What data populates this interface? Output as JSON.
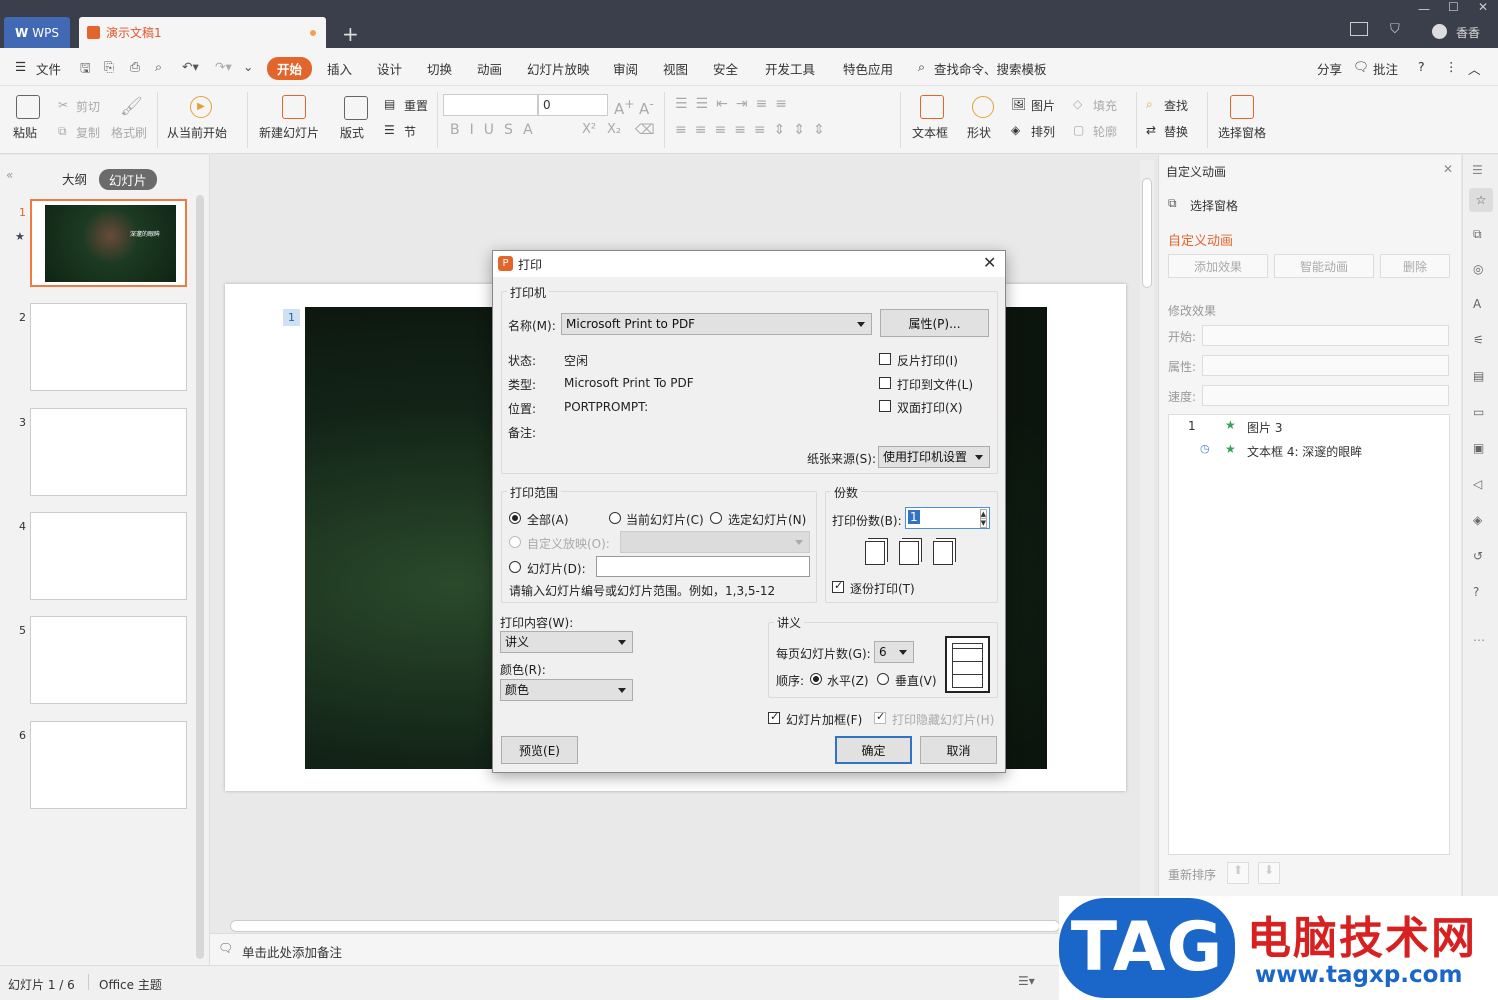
{
  "titlebar": {
    "wps_tab": "WPS",
    "doc_tab": "演示文稿1",
    "user": "香香"
  },
  "menu": {
    "file": "文件",
    "items": [
      "开始",
      "插入",
      "设计",
      "切换",
      "动画",
      "幻灯片放映",
      "审阅",
      "视图",
      "安全",
      "开发工具",
      "特色应用"
    ],
    "search": "查找命令、搜索模板",
    "share": "分享",
    "comment": "批注"
  },
  "toolbar": {
    "paste": "粘贴",
    "cut": "剪切",
    "copy": "复制",
    "format_painter": "格式刷",
    "from_current": "从当前开始",
    "new_slide": "新建幻灯片",
    "layout": "版式",
    "reset": "重置",
    "section": "节",
    "font_size": "0",
    "textbox": "文本框",
    "shape": "形状",
    "picture": "图片",
    "fill": "填充",
    "arrange": "排列",
    "outline": "轮廓",
    "find": "查找",
    "replace": "替换",
    "select_pane": "选择窗格"
  },
  "leftpane": {
    "tab_outline": "大纲",
    "tab_slides": "幻灯片",
    "slides": [
      "1",
      "2",
      "3",
      "4",
      "5",
      "6"
    ],
    "slide1_caption": "深邃的眼眸"
  },
  "slide": {
    "number": "1"
  },
  "rightpane": {
    "title": "自定义动画",
    "select_pane": "选择窗格",
    "section": "自定义动画",
    "add_effect": "添加效果",
    "smart_anim": "智能动画",
    "delete": "删除",
    "modify": "修改效果",
    "start": "开始:",
    "property": "属性:",
    "speed": "速度:",
    "list": [
      {
        "num": "1",
        "name": "图片 3"
      },
      {
        "num": "",
        "name": "文本框 4: 深邃的眼眸"
      }
    ],
    "reorder": "重新排序"
  },
  "notes": {
    "placeholder": "单击此处添加备注"
  },
  "status": {
    "slide_count": "幻灯片 1 / 6",
    "theme": "Office 主题"
  },
  "dialog": {
    "title": "打印",
    "printer_group": "打印机",
    "name_label": "名称(M):",
    "printer_name": "Microsoft Print to PDF",
    "properties": "属性(P)...",
    "status_label": "状态:",
    "status_value": "空闲",
    "type_label": "类型:",
    "type_value": "Microsoft Print To PDF",
    "where_label": "位置:",
    "where_value": "PORTPROMPT:",
    "comment_label": "备注:",
    "reverse": "反片打印(I)",
    "to_file": "打印到文件(L)",
    "duplex": "双面打印(X)",
    "paper_source_label": "纸张来源(S):",
    "paper_source": "使用打印机设置",
    "range_group": "打印范围",
    "all": "全部(A)",
    "current": "当前幻灯片(C)",
    "selected": "选定幻灯片(N)",
    "custom": "自定义放映(O):",
    "slides": "幻灯片(D):",
    "hint": "请输入幻灯片编号或幻灯片范围。例如，1,3,5-12",
    "copies_group": "份数",
    "copies_label": "打印份数(B):",
    "copies_value": "1",
    "collate": "逐份打印(T)",
    "content_label": "打印内容(W):",
    "content_value": "讲义",
    "color_label": "颜色(R):",
    "color_value": "颜色",
    "handout_group": "讲义",
    "per_page_label": "每页幻灯片数(G):",
    "per_page_value": "6",
    "order_label": "顺序:",
    "horizontal": "水平(Z)",
    "vertical": "垂直(V)",
    "frame": "幻灯片加框(F)",
    "print_hidden": "打印隐藏幻灯片(H)",
    "preview": "预览(E)",
    "ok": "确定",
    "cancel": "取消"
  },
  "watermark": {
    "tag": "TAG",
    "cn": "电脑技术网",
    "url": "www.tagxp.com"
  },
  "colors": {
    "accent": "#e2652b",
    "wps_blue": "#4269b3",
    "titlebar": "#3b3f4c"
  }
}
